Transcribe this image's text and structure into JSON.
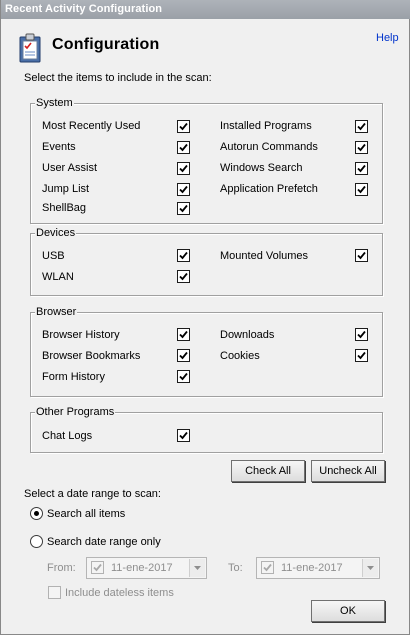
{
  "window": {
    "title": "Recent Activity Configuration"
  },
  "header": {
    "title": "Configuration",
    "help_label": "Help",
    "icon": "checklist-icon"
  },
  "instruction": "Select the items to include in the scan:",
  "groups": {
    "system": {
      "legend": "System",
      "items": [
        {
          "label": "Most Recently Used",
          "checked": true
        },
        {
          "label": "Events",
          "checked": true
        },
        {
          "label": "User Assist",
          "checked": true
        },
        {
          "label": "Jump List",
          "checked": true
        },
        {
          "label": "ShellBag",
          "checked": true
        },
        {
          "label": "Installed Programs",
          "checked": true
        },
        {
          "label": "Autorun Commands",
          "checked": true
        },
        {
          "label": "Windows Search",
          "checked": true
        },
        {
          "label": "Application Prefetch",
          "checked": true
        }
      ]
    },
    "devices": {
      "legend": "Devices",
      "items": [
        {
          "label": "USB",
          "checked": true
        },
        {
          "label": "WLAN",
          "checked": true
        },
        {
          "label": "Mounted Volumes",
          "checked": true
        }
      ]
    },
    "browser": {
      "legend": "Browser",
      "items": [
        {
          "label": "Browser History",
          "checked": true
        },
        {
          "label": "Browser Bookmarks",
          "checked": true
        },
        {
          "label": "Form History",
          "checked": true
        },
        {
          "label": "Downloads",
          "checked": true
        },
        {
          "label": "Cookies",
          "checked": true
        }
      ]
    },
    "other": {
      "legend": "Other Programs",
      "items": [
        {
          "label": "Chat Logs",
          "checked": true
        }
      ]
    }
  },
  "buttons": {
    "check_all": "Check All",
    "uncheck_all": "Uncheck All",
    "ok": "OK"
  },
  "date_range": {
    "prompt": "Select a date range to scan:",
    "option_all": "Search all items",
    "option_range": "Search date range only",
    "selected": "all",
    "from_label": "From:",
    "from_value": "11-ene-2017",
    "to_label": "To:",
    "to_value": "11-ene-2017",
    "include_dateless": "Include dateless items"
  }
}
